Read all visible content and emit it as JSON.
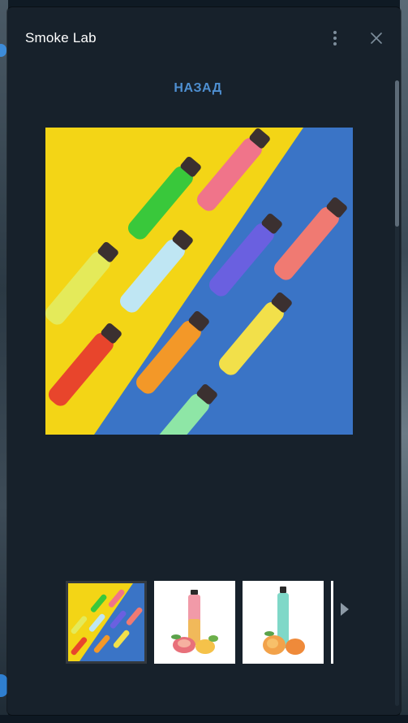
{
  "window": {
    "title": "Smoke Lab"
  },
  "header": {
    "menu_icon": "kebab-vertical-icon",
    "close_icon": "close-icon"
  },
  "main": {
    "back_label": "НАЗАД"
  },
  "gallery": {
    "images": [
      {
        "name": "vapes-yellow-blue-background",
        "selected": true
      },
      {
        "name": "vape-pink-guava-fruit",
        "selected": false
      },
      {
        "name": "vape-mint-peach-fruit",
        "selected": false
      }
    ],
    "next_icon": "chevron-right-icon"
  },
  "colors": {
    "panel": "#17212b",
    "accent": "#4e8fd1",
    "title": "#ffffff",
    "yellow": "#f3d516",
    "blue": "#3a74c6"
  }
}
